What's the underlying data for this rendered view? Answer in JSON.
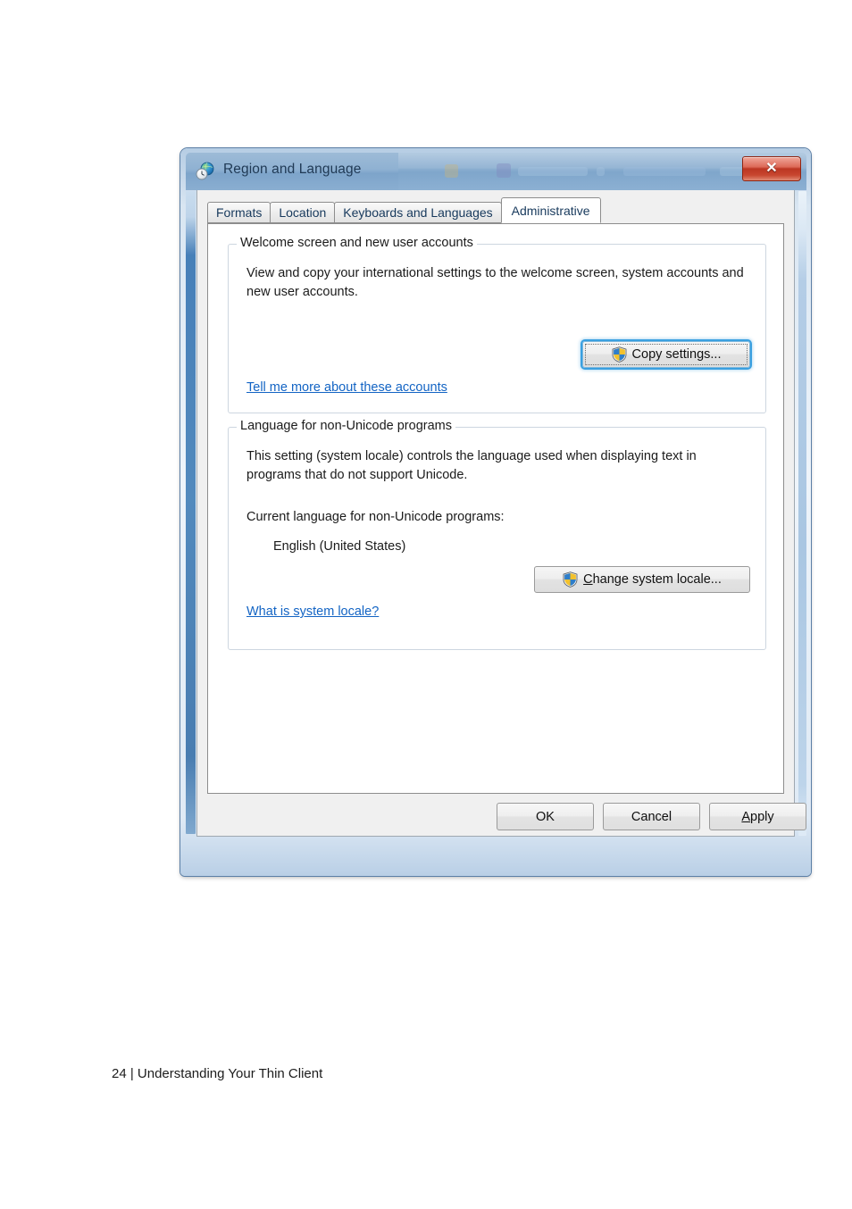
{
  "window": {
    "title": "Region and Language",
    "icon": "region-globe-clock-icon",
    "close_label": "✕",
    "close_icon": "close-icon"
  },
  "tabs": [
    {
      "label": "Formats",
      "selected": false
    },
    {
      "label": "Location",
      "selected": false
    },
    {
      "label": "Keyboards and Languages",
      "selected": false
    },
    {
      "label": "Administrative",
      "selected": true
    }
  ],
  "groups": {
    "welcome": {
      "legend": "Welcome screen and new user accounts",
      "description": "View and copy your international settings to the welcome screen, system accounts and new user accounts.",
      "button_label": "Copy settings...",
      "button_icon": "uac-shield-icon",
      "link_label": "Tell me more about these accounts"
    },
    "language": {
      "legend": "Language for non-Unicode programs",
      "description": "This setting (system locale) controls the language used when displaying text in programs that do not support Unicode.",
      "current_label": "Current language for non-Unicode programs:",
      "current_value": "English (United States)",
      "button_accel": "C",
      "button_label_rest": "hange system locale...",
      "button_icon": "uac-shield-icon",
      "link_label": "What is system locale?"
    }
  },
  "footer_buttons": {
    "ok": "OK",
    "cancel": "Cancel",
    "apply_accel": "A",
    "apply_rest": "pply"
  },
  "page": {
    "footer_text": "24 | Understanding Your Thin Client"
  },
  "colors": {
    "title_bar": "#8fb1d2",
    "close_button": "#bc3622",
    "link": "#1364c4",
    "focus_ring": "#3aa0e0",
    "group_border": "#cdd6e0",
    "dialog_bg": "#f0f0f0",
    "page_bg": "#ffffff"
  }
}
